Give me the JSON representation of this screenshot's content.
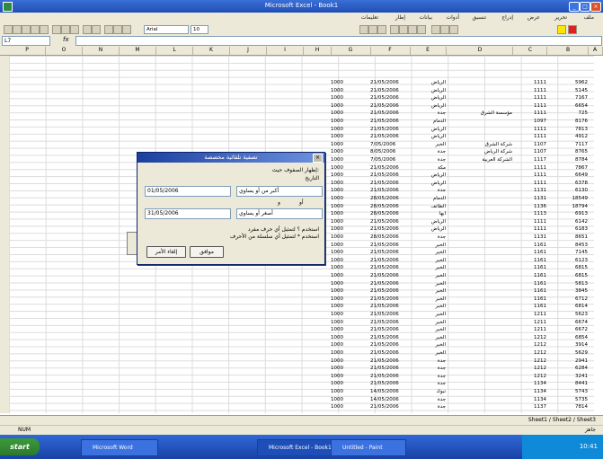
{
  "window": {
    "title": "Microsoft Excel - Book1"
  },
  "menubar": {
    "items": [
      "تعليمات",
      "إطار",
      "بيانات",
      "أدوات",
      "تنسيق",
      "إدراج",
      "عرض",
      "تحرير",
      "ملف"
    ]
  },
  "toolbar": {
    "font_size": "10",
    "font_name": "Arial"
  },
  "formula_bar": {
    "name_box": "L7",
    "fx": "fx"
  },
  "columns": [
    "A",
    "B",
    "C",
    "D",
    "E",
    "F",
    "G",
    "H",
    "I",
    "J",
    "K",
    "L",
    "M",
    "N",
    "O",
    "P"
  ],
  "table": {
    "rows": [
      {
        "n": "1000",
        "d": "21/05/2006",
        "a": "الرياض",
        "b": "",
        "c": "1111",
        "e": "5962"
      },
      {
        "n": "1000",
        "d": "21/05/2006",
        "a": "الرياض",
        "b": "",
        "c": "1111",
        "e": "5145"
      },
      {
        "n": "1000",
        "d": "21/05/2006",
        "a": "الرياض",
        "b": "",
        "c": "1111",
        "e": "7167"
      },
      {
        "n": "1000",
        "d": "21/05/2006",
        "a": "الرياض",
        "b": "",
        "c": "1111",
        "e": "6654"
      },
      {
        "n": "1000",
        "d": "21/05/2006",
        "a": "جدة",
        "b": "مؤسسة الشرق",
        "c": "1111",
        "e": "725"
      },
      {
        "n": "1000",
        "d": "21/05/2006",
        "a": "الدمام",
        "b": "",
        "c": "1097",
        "e": "8176"
      },
      {
        "n": "1000",
        "d": "21/05/2006",
        "a": "الرياض",
        "b": "",
        "c": "1111",
        "e": "7813"
      },
      {
        "n": "1000",
        "d": "21/05/2006",
        "a": "الرياض",
        "b": "",
        "c": "1111",
        "e": "4912"
      },
      {
        "n": "1000",
        "d": "7/05/2006",
        "a": "الخبر",
        "b": "شركة الشرق",
        "c": "1107",
        "e": "7117"
      },
      {
        "n": "1000",
        "d": "8/05/2006",
        "a": "جدة",
        "b": "شركة الرياض",
        "c": "1107",
        "e": "8765"
      },
      {
        "n": "1000",
        "d": "7/05/2006",
        "a": "جدة",
        "b": "الشركة العربية",
        "c": "1117",
        "e": "8784"
      },
      {
        "n": "1000",
        "d": "21/05/2006",
        "a": "مكة",
        "b": "",
        "c": "1111",
        "e": "7867"
      },
      {
        "n": "1000",
        "d": "21/05/2006",
        "a": "الرياض",
        "b": "",
        "c": "1111",
        "e": "6649"
      },
      {
        "n": "1000",
        "d": "21/05/2006",
        "a": "الرياض",
        "b": "",
        "c": "1111",
        "e": "6378"
      },
      {
        "n": "1000",
        "d": "21/05/2006",
        "a": "جدة",
        "b": "",
        "c": "1131",
        "e": "6130"
      },
      {
        "n": "1000",
        "d": "28/05/2006",
        "a": "الدمام",
        "b": "",
        "c": "1131",
        "e": "18549"
      },
      {
        "n": "1000",
        "d": "28/05/2006",
        "a": "الطائف",
        "b": "",
        "c": "1136",
        "e": "18794"
      },
      {
        "n": "1000",
        "d": "28/05/2006",
        "a": "أبها",
        "b": "",
        "c": "1113",
        "e": "6913"
      },
      {
        "n": "1000",
        "d": "21/05/2006",
        "a": "الرياض",
        "b": "",
        "c": "1111",
        "e": "6142"
      },
      {
        "n": "1000",
        "d": "21/05/2006",
        "a": "الرياض",
        "b": "",
        "c": "1111",
        "e": "6183"
      },
      {
        "n": "1000",
        "d": "28/05/2006",
        "a": "جدة",
        "b": "",
        "c": "1131",
        "e": "8651"
      },
      {
        "n": "1000",
        "d": "21/05/2006",
        "a": "الخبر",
        "b": "",
        "c": "1161",
        "e": "8453"
      },
      {
        "n": "1000",
        "d": "21/05/2006",
        "a": "الخبر",
        "b": "",
        "c": "1161",
        "e": "7145"
      },
      {
        "n": "1000",
        "d": "21/05/2006",
        "a": "الخبر",
        "b": "",
        "c": "1161",
        "e": "6123"
      },
      {
        "n": "1000",
        "d": "21/05/2006",
        "a": "الخبر",
        "b": "",
        "c": "1161",
        "e": "6815"
      },
      {
        "n": "1000",
        "d": "21/05/2006",
        "a": "الخبر",
        "b": "",
        "c": "1161",
        "e": "6815"
      },
      {
        "n": "1000",
        "d": "21/05/2006",
        "a": "الخبر",
        "b": "",
        "c": "1161",
        "e": "5813"
      },
      {
        "n": "1000",
        "d": "21/05/2006",
        "a": "الخبر",
        "b": "",
        "c": "1161",
        "e": "3845"
      },
      {
        "n": "1000",
        "d": "21/05/2006",
        "a": "الخبر",
        "b": "",
        "c": "1161",
        "e": "6712"
      },
      {
        "n": "1000",
        "d": "21/05/2006",
        "a": "الخبر",
        "b": "",
        "c": "1161",
        "e": "6814"
      },
      {
        "n": "1000",
        "d": "21/05/2006",
        "a": "الخبر",
        "b": "",
        "c": "1211",
        "e": "5623"
      },
      {
        "n": "1000",
        "d": "21/05/2006",
        "a": "الخبر",
        "b": "",
        "c": "1211",
        "e": "6674"
      },
      {
        "n": "1000",
        "d": "21/05/2006",
        "a": "الخبر",
        "b": "",
        "c": "1211",
        "e": "6672"
      },
      {
        "n": "1000",
        "d": "21/05/2006",
        "a": "الخبر",
        "b": "",
        "c": "1212",
        "e": "6854"
      },
      {
        "n": "1000",
        "d": "21/05/2006",
        "a": "الخبر",
        "b": "",
        "c": "1212",
        "e": "3914"
      },
      {
        "n": "1000",
        "d": "21/05/2006",
        "a": "الخبر",
        "b": "",
        "c": "1212",
        "e": "5629"
      },
      {
        "n": "1000",
        "d": "21/05/2006",
        "a": "جدة",
        "b": "",
        "c": "1212",
        "e": "2941"
      },
      {
        "n": "1000",
        "d": "21/05/2006",
        "a": "جدة",
        "b": "",
        "c": "1212",
        "e": "6284"
      },
      {
        "n": "1000",
        "d": "21/05/2006",
        "a": "جدة",
        "b": "",
        "c": "1212",
        "e": "3241"
      },
      {
        "n": "1000",
        "d": "21/05/2006",
        "a": "جدة",
        "b": "",
        "c": "1134",
        "e": "8441"
      },
      {
        "n": "1000",
        "d": "14/05/2006",
        "a": "تبوك",
        "b": "",
        "c": "1134",
        "e": "5743"
      },
      {
        "n": "1000",
        "d": "14/05/2006",
        "a": "جدة",
        "b": "",
        "c": "1134",
        "e": "5735"
      },
      {
        "n": "1000",
        "d": "21/05/2006",
        "a": "جدة",
        "b": "",
        "c": "1137",
        "e": "7814"
      }
    ]
  },
  "dialog": {
    "title": "تصفية تلقائية مخصصة",
    "close": "×",
    "show_rows": "إظهار الصفوف حيث:",
    "field_label": "التاريخ",
    "op1": "أكبر من أو يساوي",
    "val1": "01/05/2006",
    "and": "و",
    "or": "أو",
    "op2": "أصغر أو يساوي",
    "val2": "31/05/2006",
    "hint1": "استخدم ؟ لتمثيل أي حرف مفرد",
    "hint2": "استخدم * لتمثيل أي سلسلة من الأحرف",
    "ok": "موافق",
    "cancel": "إلغاء الأمر"
  },
  "sheettabs": {
    "status": "Sheet1 / Sheet2 / Sheet3"
  },
  "statusbar": {
    "left": "جاهز",
    "right": "NUM"
  },
  "taskbar": {
    "start": "start",
    "items": [
      "Microsoft Word",
      "Microsoft Excel - Book1",
      "Untitled - Paint"
    ],
    "clock": "10:41"
  }
}
